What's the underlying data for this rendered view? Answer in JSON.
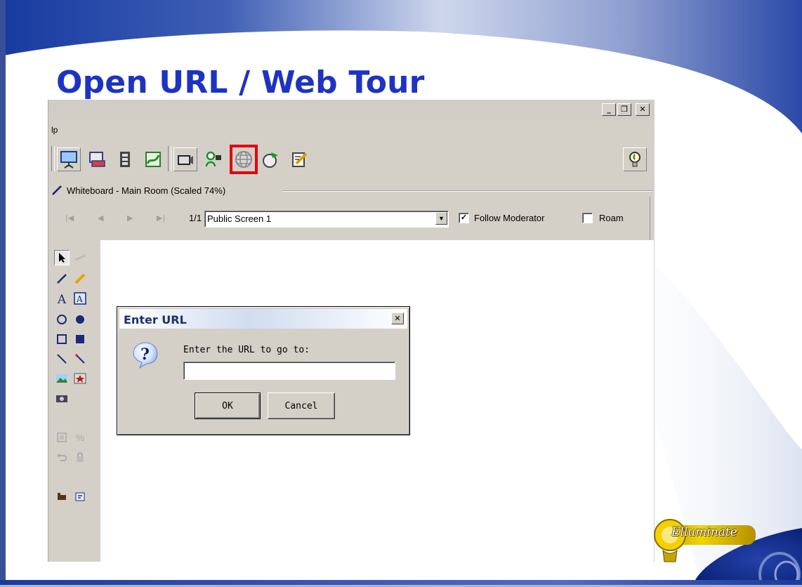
{
  "slide": {
    "title": "Open URL / Web Tour"
  },
  "window": {
    "controls": {
      "minimize": "_",
      "maximize": "❒",
      "close": "✕"
    },
    "menu_label": "lp",
    "toolbar_icons": [
      "presentation-icon",
      "desktop-share-icon",
      "filmstrip-icon",
      "map-icon",
      "video-camera-icon",
      "camera-person-icon",
      "web-globe-icon",
      "web-tour-icon",
      "notes-edit-icon"
    ],
    "highlighted_tool": "web-globe-icon",
    "help_icon": "lightbulb-icon"
  },
  "whiteboard": {
    "title": "Whiteboard - Main Room (Scaled 74%)",
    "page_counter": "1/1",
    "screen_select_value": "Public Screen 1",
    "follow_moderator_label": "Follow Moderator",
    "follow_moderator_checked": true,
    "roam_label": "Roam",
    "roam_checked": false,
    "tools": [
      "select-arrow-icon",
      "pointer-icon",
      "pen-icon",
      "highlighter-icon",
      "text-icon",
      "text-box-icon",
      "ellipse-icon",
      "filled-ellipse-icon",
      "rectangle-icon",
      "filled-rectangle-icon",
      "line-icon",
      "magic-wand-icon",
      "image-icon",
      "clipart-icon",
      "screen-capture-icon",
      "group-icon",
      "percent-zoom-icon",
      "undo-icon",
      "lock-icon",
      "folder-icon",
      "properties-icon"
    ]
  },
  "dialog": {
    "title": "Enter URL",
    "close": "✕",
    "prompt": "Enter the URL to go to:",
    "input_value": "",
    "ok_label": "OK",
    "cancel_label": "Cancel",
    "icon": "question-icon"
  },
  "logo": {
    "text": "Elluminate"
  },
  "colors": {
    "title_blue": "#1d33c2",
    "highlight_red": "#e3000f",
    "window_gray": "#d4d0c8"
  }
}
